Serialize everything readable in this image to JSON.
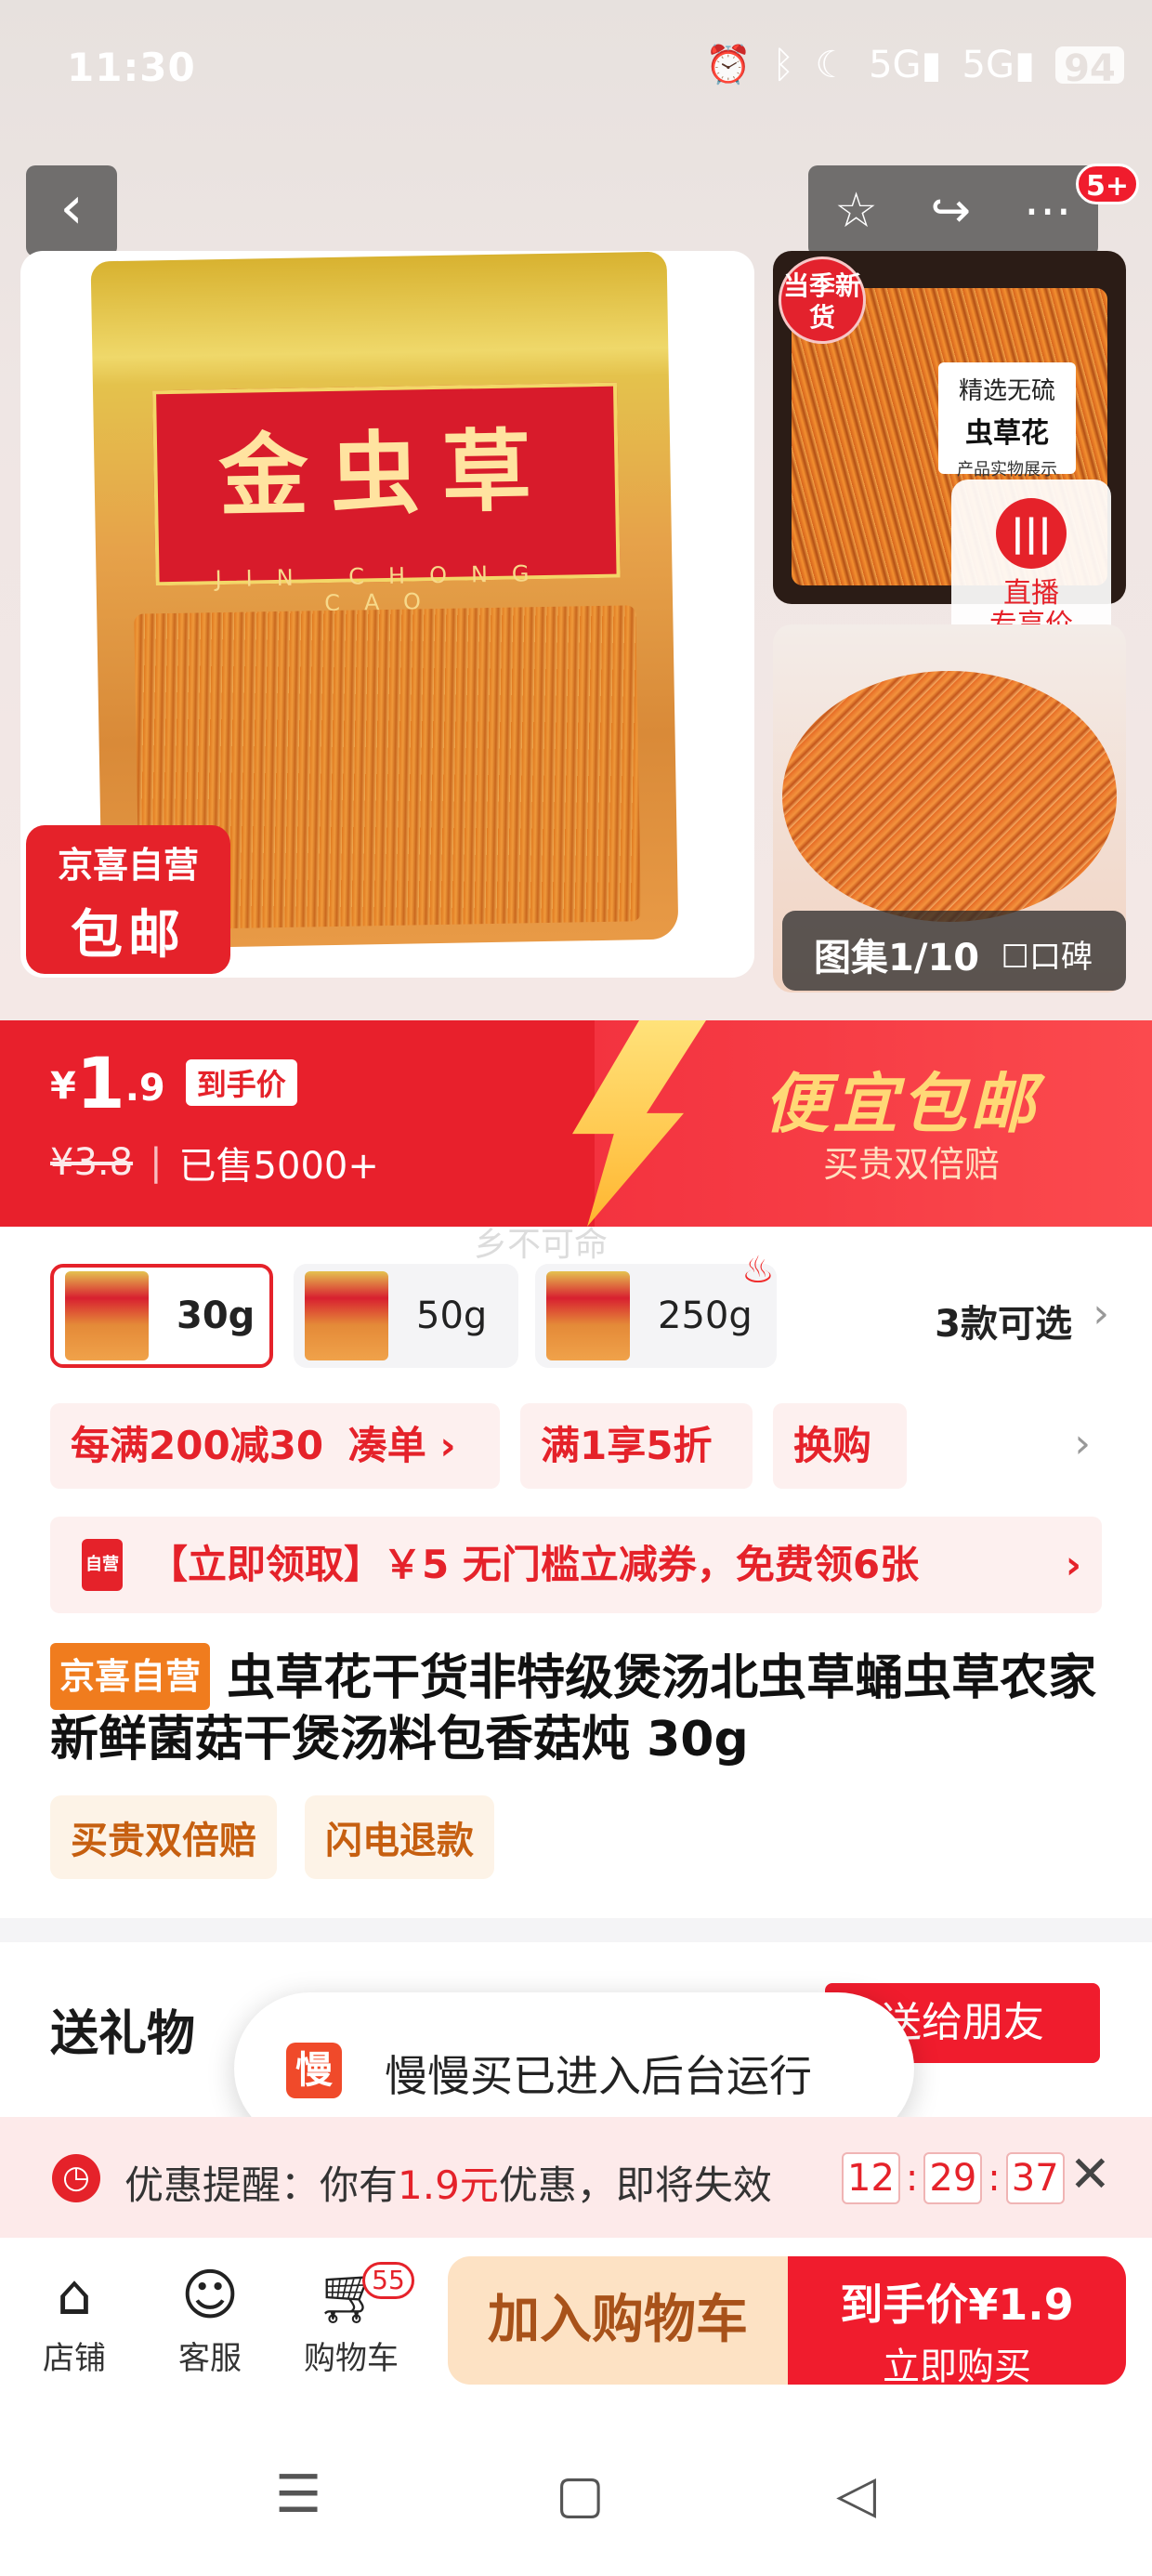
{
  "status_bar": {
    "time": "11:30",
    "icons": [
      "alarm-icon",
      "bluetooth-icon",
      "moon-icon",
      "signal-5g-icon",
      "signal-5g-icon"
    ],
    "battery": "94",
    "network_1": "5G",
    "network_2": "5G"
  },
  "gallery": {
    "badge_count": "5+",
    "main_bag_label": "金虫草",
    "main_bag_sub": "JIN CHONG CAO",
    "promo_line1": "京喜自营",
    "promo_line2": "包邮",
    "season_tag": "当季新货",
    "select_card": {
      "line1": "精选无硫",
      "line2": "虫草花",
      "line3": "产品实物展示"
    },
    "live": {
      "line1": "直播",
      "line2": "专享价"
    },
    "counter": "图集1/10",
    "review": "口碑"
  },
  "price": {
    "currency": "¥",
    "integer": "1",
    "decimal": ".9",
    "tag": "到手价",
    "original": "¥3.8",
    "sold": "已售5000+",
    "banner_title": "便宜包邮",
    "banner_sub": "买贵双倍赔"
  },
  "watermark": "乡不可命",
  "options": {
    "items": [
      {
        "label": "30g"
      },
      {
        "label": "50g"
      },
      {
        "label": "250g"
      }
    ],
    "count": "3款可选"
  },
  "promos": {
    "chip1": "每满200减30",
    "chip1_action": "凑单 ›",
    "chip2": "满1享5折",
    "chip3": "换购"
  },
  "coupon": {
    "icon_text": "自营",
    "text": "【立即领取】￥5 无门槛立减券，免费领6张"
  },
  "product": {
    "self_tag": "京喜自营",
    "title": "虫草花干货非特级煲汤北虫草蛹虫草农家新鲜菌菇干煲汤料包香菇炖 30g",
    "service_tags": [
      "买贵双倍赔",
      "闪电退款"
    ]
  },
  "gift": {
    "title": "送礼物",
    "button": "送给朋友"
  },
  "toast": {
    "icon_text": "慢",
    "message": "慢慢买已进入后台运行"
  },
  "reminder": {
    "prefix": "优惠提醒：你有",
    "amount": "1.9元",
    "suffix": "优惠，即将失效",
    "hh": "12",
    "mm": "29",
    "ss": "37"
  },
  "action_bar": {
    "store": "店铺",
    "service": "客服",
    "cart": "购物车",
    "cart_count": "55",
    "add_to_cart": "加入购物车",
    "buy_price": "到手价¥1.9",
    "buy_now": "立即购买"
  }
}
